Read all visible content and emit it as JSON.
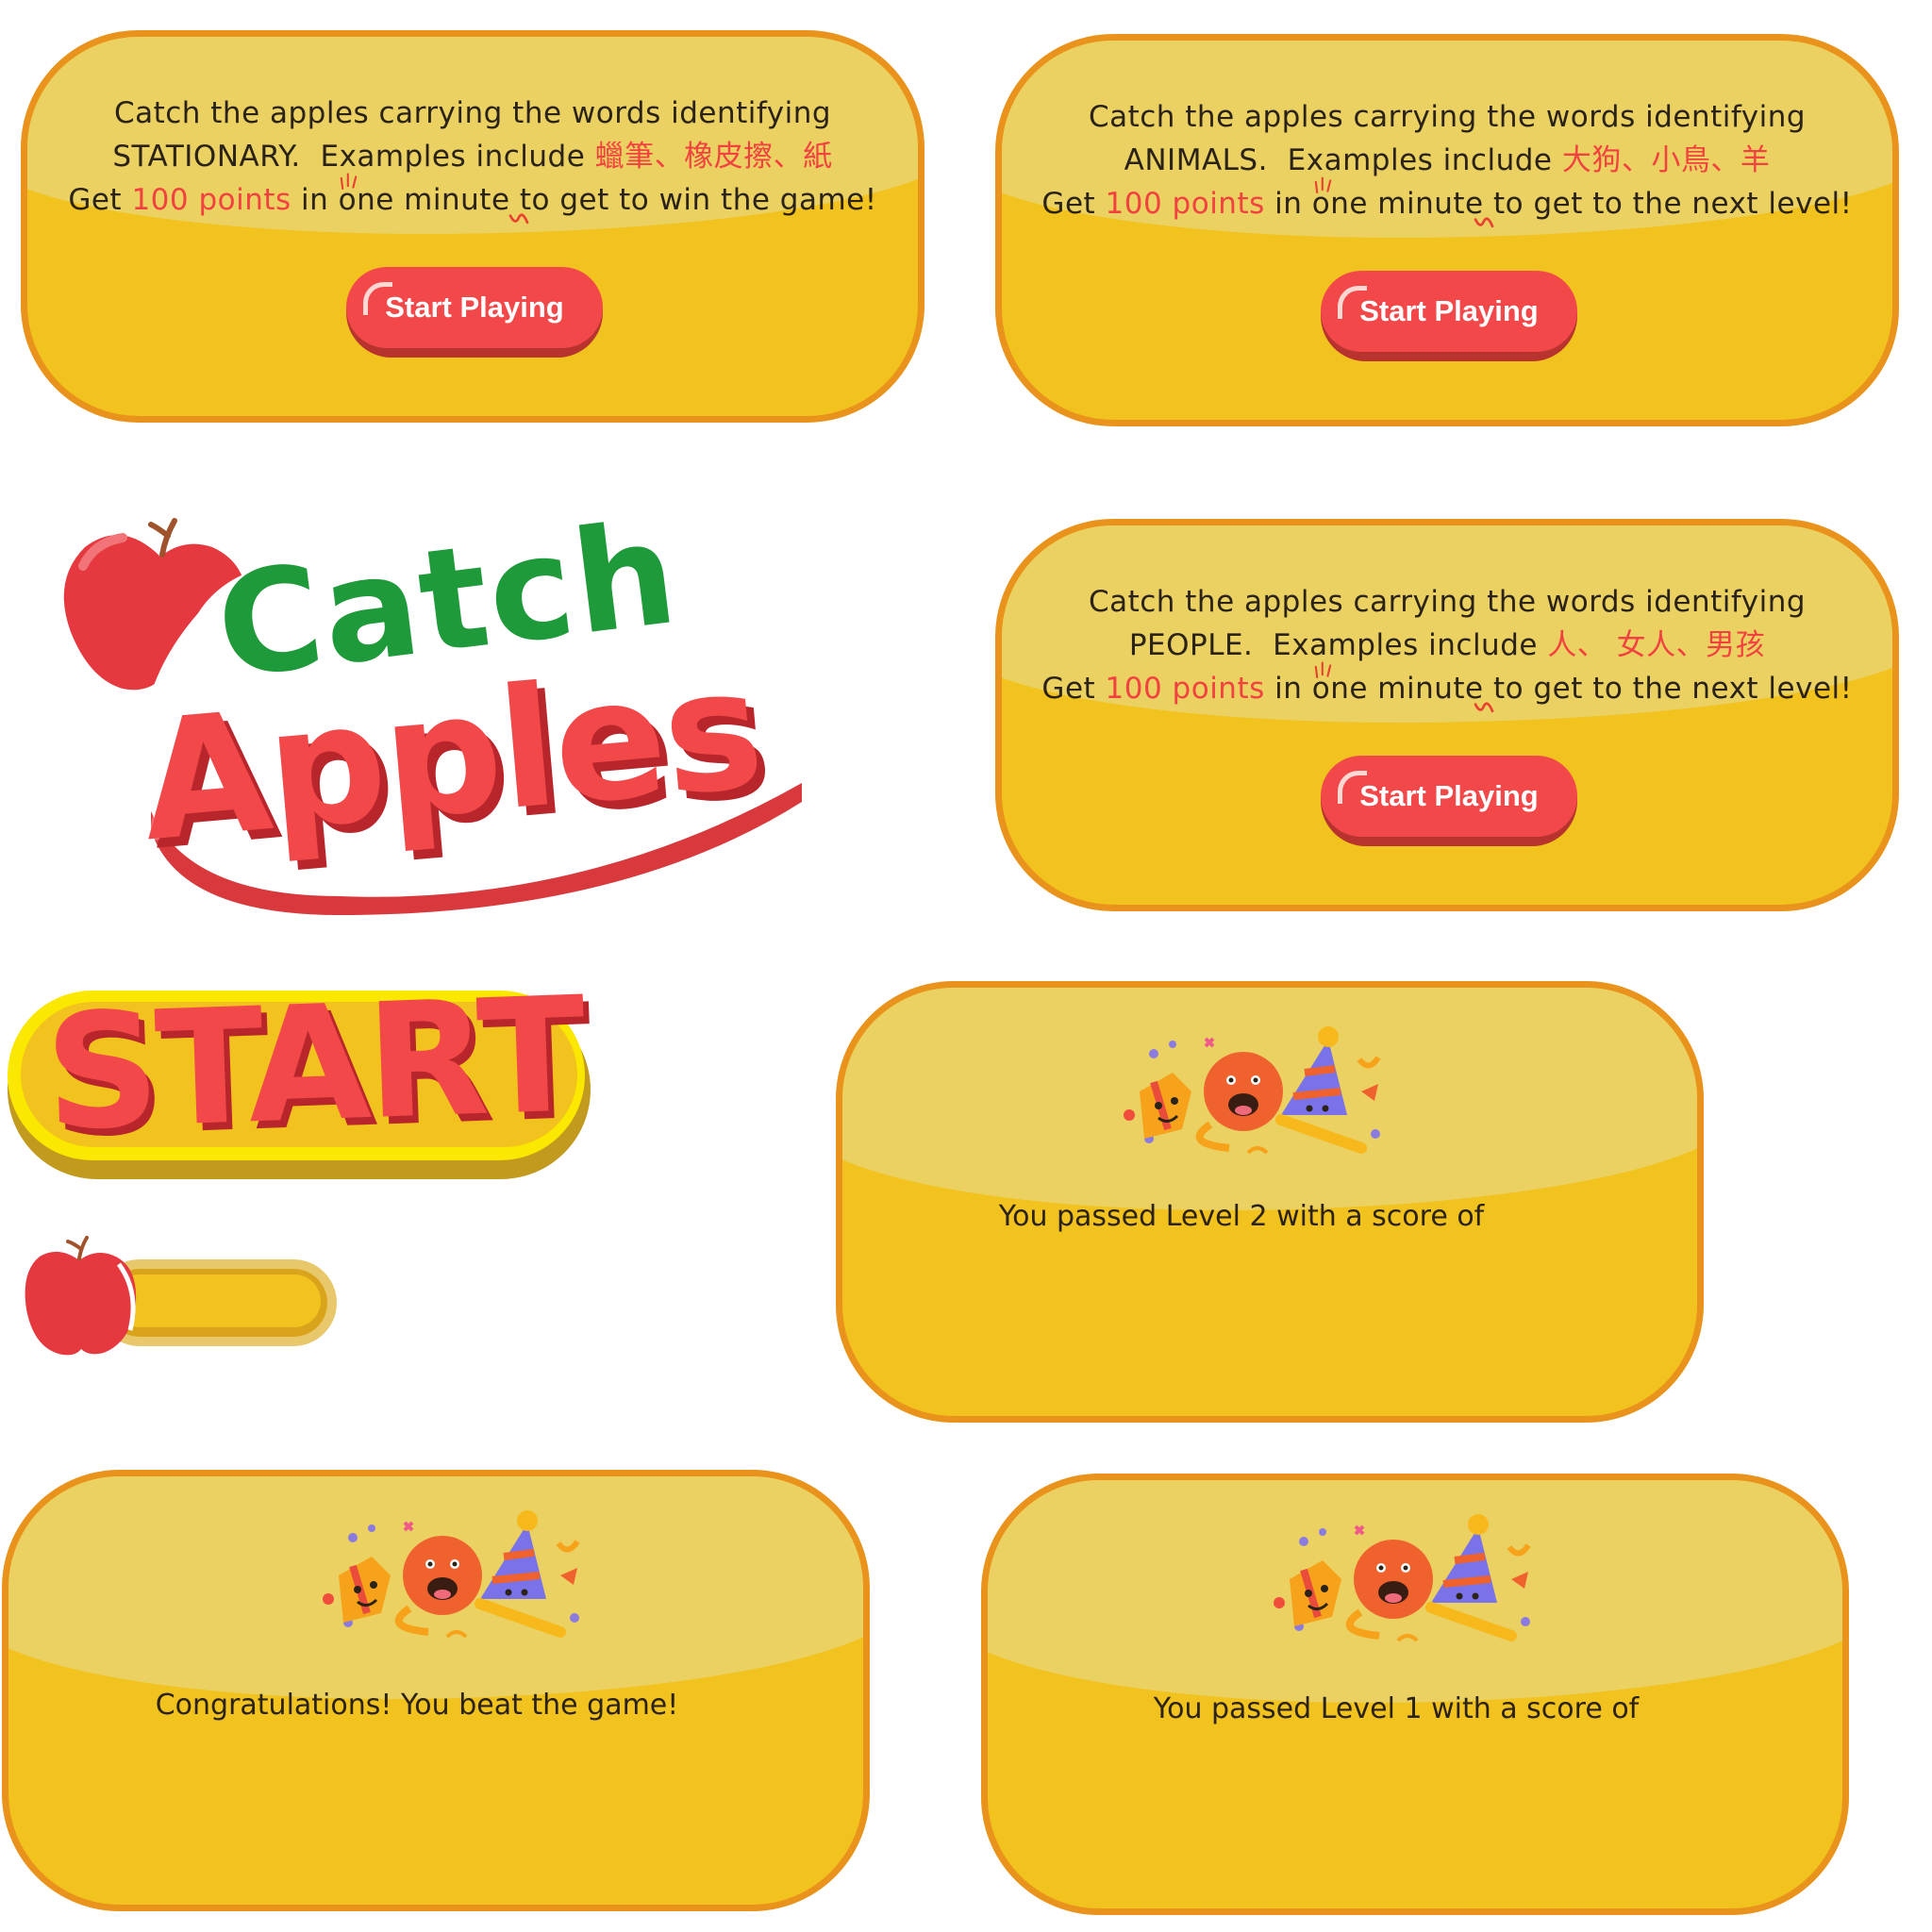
{
  "panels": {
    "stationary": {
      "line1": "Catch the apples carrying the words identifying",
      "category": "STATIONARY.",
      "examples_prefix": "Examples include",
      "examples": "蠟筆、橡皮擦、紙",
      "get": "Get",
      "points": "100 points",
      "goal": "in one minute to get to win the game!",
      "button": "Start Playing"
    },
    "animals": {
      "line1": "Catch the apples carrying the words identifying",
      "category": "ANIMALS.",
      "examples_prefix": "Examples include",
      "examples": "大狗、小鳥、羊",
      "get": "Get",
      "points": "100 points",
      "goal": "in one minute to get to the next level!",
      "button": "Start Playing"
    },
    "people": {
      "line1": "Catch the apples carrying the words identifying",
      "category": "PEOPLE.",
      "examples_prefix": "Examples include",
      "examples": "人、 女人、男孩",
      "get": "Get",
      "points": "100 points",
      "goal": "in one minute to get to the next level!",
      "button": "Start Playing"
    }
  },
  "logo": {
    "line1": "Catch",
    "line2": "Apples"
  },
  "start_button": {
    "label": "START"
  },
  "progress": {
    "fill_fraction": 0.0
  },
  "results": {
    "level2": "You passed Level 2 with a score of",
    "win": "Congratulations! You beat the game!",
    "level1": "You passed Level 1 with a score of"
  },
  "colors": {
    "panel_fill": "#f2c21e",
    "panel_border": "#e9921c",
    "highlight_red": "#f2423f",
    "logo_green": "#1f9a3a"
  }
}
